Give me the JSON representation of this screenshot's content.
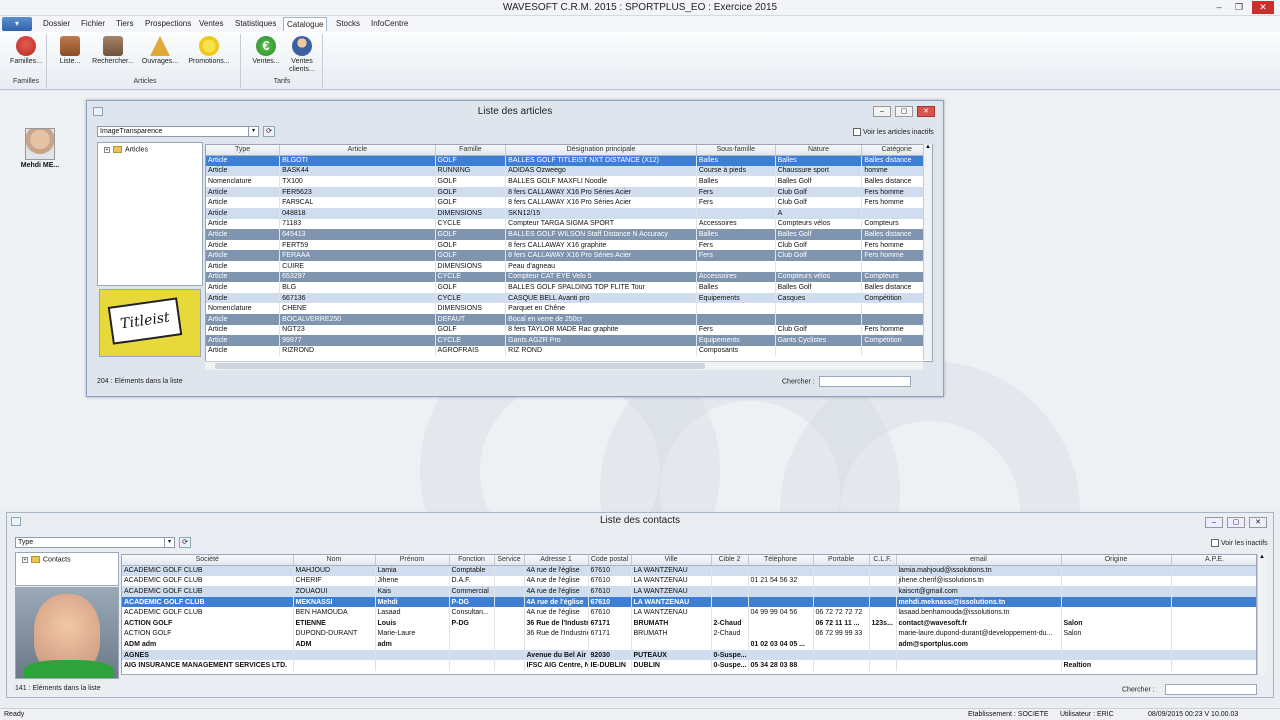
{
  "app": {
    "title": "WAVESOFT C.R.M. 2015 : SPORTPLUS_EO : Exercice 2015"
  },
  "menu": [
    "Dossier",
    "Fichier",
    "Tiers",
    "Prospections",
    "Ventes",
    "Statistiques",
    "Catalogue",
    "Stocks",
    "InfoCentre"
  ],
  "ribbon": {
    "buttons": [
      {
        "label": "Familles...",
        "icon": "families-icon",
        "color": "#d4423a"
      },
      {
        "label": "Liste...",
        "icon": "list-icon",
        "color": "#a2683f"
      },
      {
        "label": "Rechercher...",
        "icon": "search-icon",
        "color": "#8a6b4f"
      },
      {
        "label": "Ouvrages...",
        "icon": "pyramid-icon",
        "color": "#e0a93b"
      },
      {
        "label": "Promotions...",
        "icon": "sun-icon",
        "color": "#f2d22b"
      },
      {
        "label": "Ventes...",
        "icon": "euro-icon",
        "color": "#3fa33a"
      },
      {
        "label": "Ventes clients...",
        "icon": "client-icon",
        "color": "#3a5fa3"
      }
    ],
    "groups": [
      "Familles",
      "Articles",
      "Tarifs"
    ]
  },
  "user": {
    "name": "Mehdi ME..."
  },
  "articles": {
    "title": "Liste des articles",
    "filter": "ImageTransparence",
    "inactive_label": "Voir les articles inactifs",
    "tree_root": "Articles",
    "columns": [
      "Type",
      "Article",
      "Famille",
      "Désignation principale",
      "Sous-famille",
      "Nature",
      "Catégorie"
    ],
    "rows": [
      [
        "Article",
        "BLGOTI",
        "GOLF",
        "BALLES GOLF TITLEIST NXT DISTANCE (X12)",
        "Balles",
        "Balles",
        "Balles distance"
      ],
      [
        "Article",
        "BASK44",
        "RUNNING",
        "ADIDAS Ozweego",
        "Course à pieds",
        "Chaussure sport",
        "homme"
      ],
      [
        "Nomenclature",
        "TX100",
        "GOLF",
        "BALLES GOLF MAXFLI Noodle",
        "Balles",
        "Balles Golf",
        "Balles distance"
      ],
      [
        "Article",
        "FER5623",
        "GOLF",
        "8 fers CALLAWAY X16 Pro Séries Acier",
        "Fers",
        "Club Golf",
        "Fers homme"
      ],
      [
        "Article",
        "FAR9CAL",
        "GOLF",
        "8 fers CALLAWAY X16 Pro Séries Acier",
        "Fers",
        "Club Golf",
        "Fers homme"
      ],
      [
        "Article",
        "048818",
        "DIMENSIONS",
        "SKN12/15",
        "",
        "A",
        ""
      ],
      [
        "Article",
        "71183",
        "CYCLE",
        "Compteur TARGA SIGMA SPORT",
        "Accessoires",
        "Compteurs vélos",
        "Compteurs"
      ],
      [
        "Article",
        "645413",
        "GOLF",
        "BALLES GOLF WILSON Staff Distance N Accuracy",
        "Balles",
        "Balles Golf",
        "Balles distance"
      ],
      [
        "Article",
        "FERT59",
        "GOLF",
        "8 fers CALLAWAY X16 graphite",
        "Fers",
        "Club Golf",
        "Fers homme"
      ],
      [
        "Article",
        "FERAAA",
        "GOLF",
        "8 fers CALLAWAY X16 Pro Séries Acier",
        "Fers",
        "Club Golf",
        "Fers homme"
      ],
      [
        "Article",
        "CUIRE",
        "DIMENSIONS",
        "Peau d'agneau",
        "",
        "",
        ""
      ],
      [
        "Article",
        "653297",
        "CYCLE",
        "Compteur CAT EYE Velo 5",
        "Accessoires",
        "Compteurs vélos",
        "Compteurs"
      ],
      [
        "Article",
        "BLG",
        "GOLF",
        "BALLES GOLF SPALDING TOP FLITE Tour",
        "Balles",
        "Balles Golf",
        "Balles distance"
      ],
      [
        "Article",
        "667136",
        "CYCLE",
        "CASQUE BELL Avanti pro",
        "Equipements",
        "Casques",
        "Compétition"
      ],
      [
        "Nomenclature",
        "CHENE",
        "DIMENSIONS",
        "Parquet en Chêne",
        "",
        "",
        ""
      ],
      [
        "Article",
        "BOCALVERRE250",
        "DEFAUT",
        "Bocal en verre de 250cr",
        "",
        "",
        ""
      ],
      [
        "Article",
        "NGT23",
        "GOLF",
        "8 fers TAYLOR MADE Rac graphite",
        "Fers",
        "Club Golf",
        "Fers homme"
      ],
      [
        "Article",
        "99977",
        "CYCLE",
        "Gants AGZR Pro",
        "Equipements",
        "Gants Cyclistes",
        "Compétition"
      ],
      [
        "Article",
        "RIZROND",
        "AGROFRAIS",
        "RIZ ROND",
        "Composants",
        "",
        ""
      ]
    ],
    "count": "204 : Eléments dans la liste",
    "search_label": "Chercher :",
    "product_image": "Titleist"
  },
  "contacts": {
    "title": "Liste des contacts",
    "filter": "Type",
    "inactive_label": "Voir les inactifs",
    "tree_root": "Contacts",
    "columns": [
      "Société",
      "Nom",
      "Prénom",
      "Fonction",
      "Service",
      "Adresse 1",
      "Code postal",
      "Ville",
      "Cible 2",
      "Téléphone",
      "Portable",
      "C.L.F.",
      "email",
      "Origine",
      "A.P.E."
    ],
    "rows": [
      [
        "ACADEMIC GOLF CLUB",
        "MAHJOUD",
        "Lamia",
        "Comptable",
        "",
        "4A rue de l'église",
        "67610",
        "LA WANTZENAU",
        "",
        "",
        "",
        "",
        "lamia.mahjoud@issolutions.tn",
        "",
        ""
      ],
      [
        "ACADEMIC GOLF CLUB",
        "CHERIF",
        "Jihene",
        "D.A.F.",
        "",
        "4A rue de l'église",
        "67610",
        "LA WANTZENAU",
        "",
        "01 21 54 56 32",
        "",
        "",
        "jihene.cherif@issolutions.tn",
        "",
        ""
      ],
      [
        "ACADEMIC GOLF CLUB",
        "ZOUAOUI",
        "Kais",
        "Commercial",
        "",
        "4A rue de l'église",
        "67610",
        "LA WANTZENAU",
        "",
        "",
        "",
        "",
        "kaiscrt@gmail.com",
        "",
        ""
      ],
      [
        "ACADEMIC GOLF CLUB",
        "MEKNASSI",
        "Mehdi",
        "P-DG",
        "",
        "4A rue de l'église",
        "67610",
        "LA WANTZENAU",
        "",
        "",
        "",
        "",
        "mehdi.meknassi@issolutions.tn",
        "",
        ""
      ],
      [
        "ACADEMIC GOLF CLUB",
        "BEN HAMOUDA",
        "Lasaad",
        "Consultan...",
        "",
        "4A rue de l'église",
        "67610",
        "LA WANTZENAU",
        "",
        "04 99 99 04 56",
        "06 72 72 72 72",
        "",
        "lasaad.benhamouda@issolutions.tn",
        "",
        ""
      ],
      [
        "ACTION GOLF",
        "ETIENNE",
        "Louis",
        "P-DG",
        "",
        "36 Rue de l'Industrie",
        "67171",
        "BRUMATH",
        "2-Chaud",
        "",
        "06 72 11 11 ...",
        "123s...",
        "contact@wavesoft.fr",
        "Salon",
        ""
      ],
      [
        "ACTION GOLF",
        "DUPOND-DURANT",
        "Marie-Laure",
        "",
        "",
        "36 Rue de l'Industrie",
        "67171",
        "BRUMATH",
        "2-Chaud",
        "",
        "06 72 99 99 33",
        "",
        "marie-laure.dupond-durant@developpement-du...",
        "Salon",
        ""
      ],
      [
        "ADM adm",
        "ADM",
        "adm",
        "",
        "",
        "",
        "",
        "",
        "",
        "01 02 03 04 05 ...",
        "",
        "",
        "adm@sportplus.com",
        "",
        ""
      ],
      [
        "AGNES",
        "",
        "",
        "",
        "",
        "Avenue du Bel Air",
        "92030",
        "PUTEAUX",
        "0-Suspe...",
        "",
        "",
        "",
        "",
        "",
        ""
      ],
      [
        "AIG INSURANCE MANAGEMENT SERVICES LTD.",
        "",
        "",
        "",
        "",
        "IFSC AIG Centre, Nort...",
        "IE-DUBLIN",
        "DUBLIN",
        "0-Suspe...",
        "05 34 28 03 88",
        "",
        "",
        "",
        "Realtion",
        ""
      ]
    ],
    "count": "141 : Eléments dans la liste",
    "search_label": "Chercher :"
  },
  "status": {
    "left": "Ready",
    "etab": "Etablissement : SOCIETE",
    "user": "Utilisateur : ERIC",
    "datetime": "08/09/2015 00:23  V 10.00.03"
  }
}
